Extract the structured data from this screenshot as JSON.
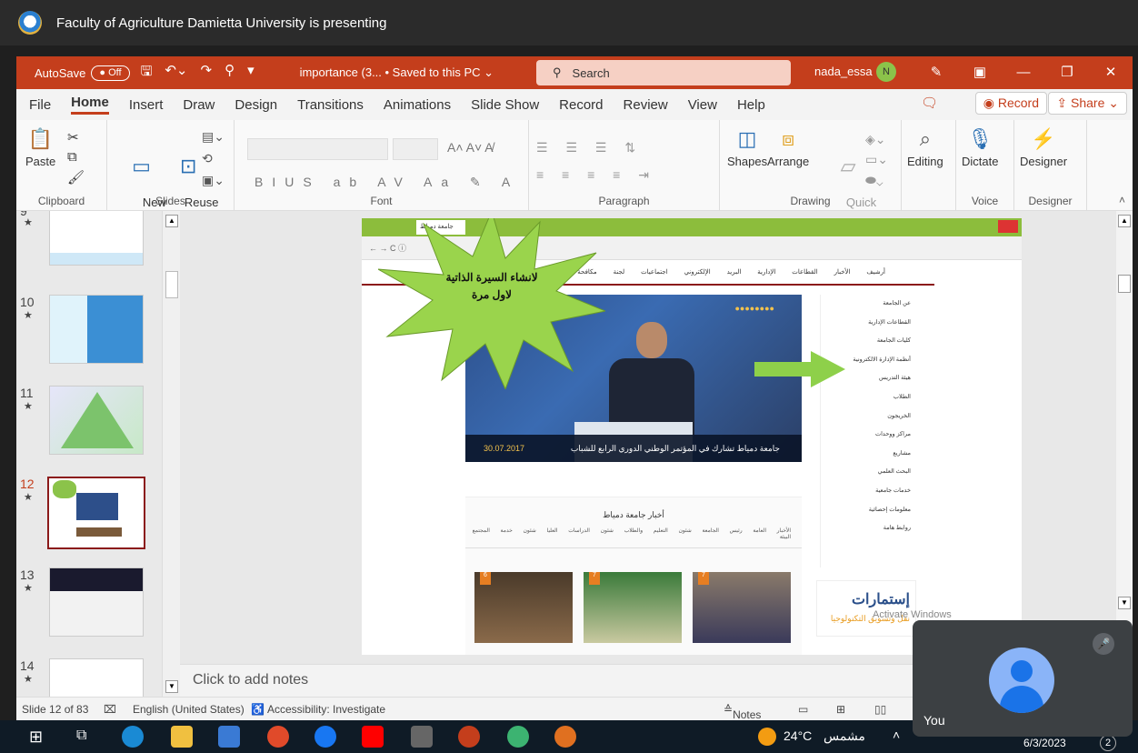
{
  "meet": {
    "presenting_text": "Faculty of Agriculture Damietta University is presenting",
    "self_name": "You"
  },
  "ppt": {
    "autosave_label": "AutoSave",
    "autosave_state": "Off",
    "doc_name": "importance (3...  • Saved to this PC ⌄",
    "search_placeholder": "Search",
    "user": "nada_essa",
    "user_initial": "N",
    "tabs": [
      "File",
      "Home",
      "Insert",
      "Draw",
      "Design",
      "Transitions",
      "Animations",
      "Slide Show",
      "Record",
      "Review",
      "View",
      "Help"
    ],
    "record_btn": "Record",
    "share_btn": "Share",
    "ribbon": {
      "paste": "Paste",
      "new_slide": "New\nSlide ⌄",
      "reuse_slides": "Reuse\nSlides",
      "shapes": "Shapes",
      "arrange": "Arrange",
      "quick_styles": "Quick\nStyles ⌄",
      "editing": "Editing",
      "dictate": "Dictate",
      "designer": "Designer",
      "groups": {
        "clipboard": "Clipboard",
        "slides": "Slides",
        "font": "Font",
        "paragraph": "Paragraph",
        "drawing": "Drawing",
        "voice": "Voice",
        "designer": "Designer"
      }
    },
    "thumbnails": [
      {
        "num": "9",
        "selected": false
      },
      {
        "num": "10",
        "selected": false
      },
      {
        "num": "11",
        "selected": false
      },
      {
        "num": "12",
        "selected": true
      },
      {
        "num": "13",
        "selected": false
      },
      {
        "num": "14",
        "selected": false
      }
    ],
    "notes_placeholder": "Click to add notes",
    "status": {
      "slide_count": "Slide 12 of 83",
      "language": "English (United States)",
      "accessibility": "Accessibility: Investigate",
      "notes": "Notes"
    }
  },
  "slide": {
    "callout_text": "لانشاء السيرة الذاتية لاول مرة",
    "browser_tab": "جامعة دمياط",
    "site_nav": "أرشيف الأخبار القطاعات الإدارية البريد الإلكتروني اجتماعيات لجنة مكافحة الفساد",
    "hero_caption": "جامعة دمياط تشارك في المؤتمر الوطني الدوري الرابع للشباب",
    "hero_date": "30.07.2017",
    "side_menu": [
      "عن الجامعة",
      "القطاعات الإدارية",
      "كليات الجامعة",
      "أنظمة الإدارة الالكترونية",
      "هيئة التدريس",
      "الطلاب",
      "الخريجون",
      "مراكز ووحدات",
      "مشاريع",
      "البحث العلمي",
      "خدمات جامعية",
      "معلومات إحصائية",
      "روابط هامة"
    ],
    "news_title": "أخبار جامعة دمياط",
    "news_tabs": "الأخبار العامة رئيس الجامعة شئون التعليم والطلاب شئون الدراسات العليا شئون خدمة المجتمع البيئة",
    "news_dates": [
      "6",
      "7",
      "7"
    ],
    "ad_title": "إستمارات",
    "ad_sub": "نقل وتسويق التكنولوجيا"
  },
  "taskbar": {
    "temperature": "24°C",
    "weather_text": "مشمس",
    "date": "6/3/2023",
    "notifications": "2"
  },
  "overlay": {
    "activate_windows": "Activate Windows"
  }
}
